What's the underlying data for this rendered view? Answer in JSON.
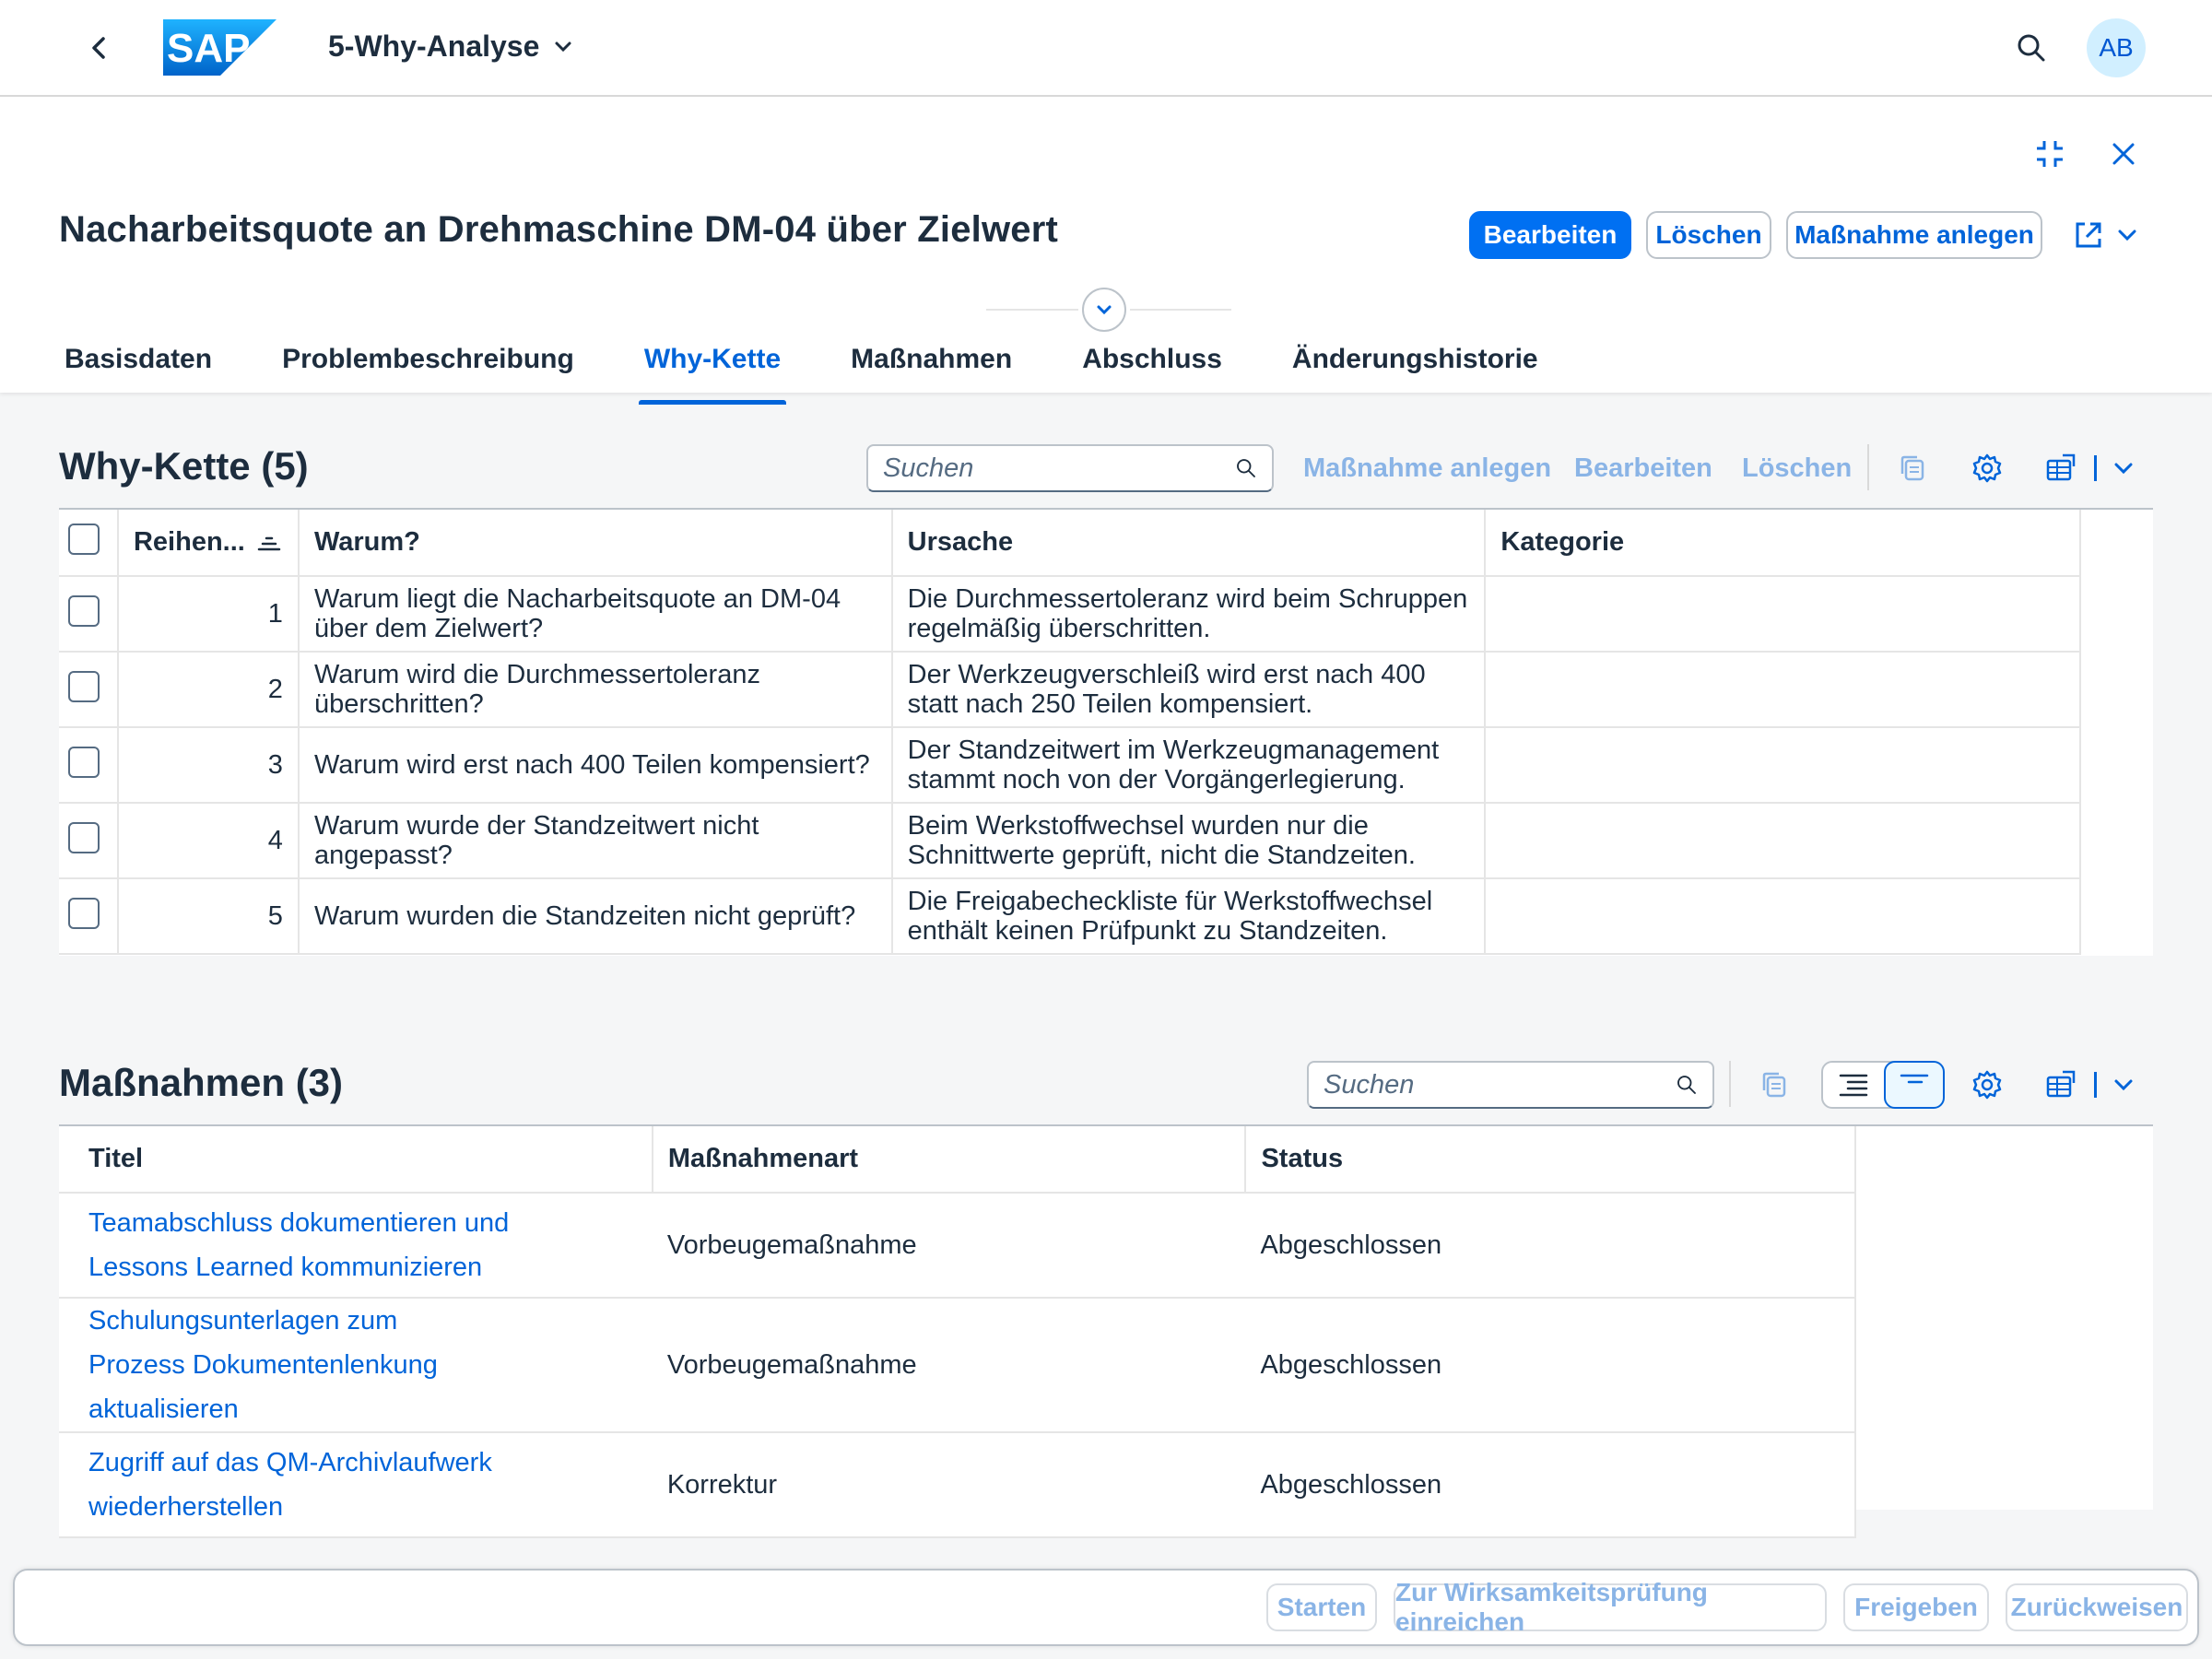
{
  "shell": {
    "app_title": "5-Why-Analyse",
    "logo_text": "SAP",
    "avatar_initials": "AB"
  },
  "header": {
    "title": "Nacharbeitsquote an Drehmaschine DM-04 über Zielwert",
    "buttons": {
      "edit": "Bearbeiten",
      "delete": "Löschen",
      "create_action": "Maßnahme anlegen"
    },
    "tabs": [
      "Basisdaten",
      "Problembeschreibung",
      "Why-Kette",
      "Maßnahmen",
      "Abschluss",
      "Änderungshistorie"
    ],
    "active_tab": "Why-Kette"
  },
  "why_chain": {
    "title": "Why-Kette (5)",
    "search_placeholder": "Suchen",
    "toolbar": {
      "create_action": "Maßnahme anlegen",
      "edit": "Bearbeiten",
      "delete": "Löschen"
    },
    "columns": [
      "Reihen...",
      "Warum?",
      "Ursache",
      "Kategorie"
    ],
    "rows": [
      {
        "order": "1",
        "why": "Warum liegt die Nacharbeitsquote an DM-04 über dem Zielwert?",
        "cause": "Die Durchmessertoleranz wird beim Schruppen regelmäßig überschritten.",
        "category": ""
      },
      {
        "order": "2",
        "why": "Warum wird die Durchmessertoleranz überschritten?",
        "cause": "Der Werkzeugverschleiß wird erst nach 400 statt nach 250 Teilen kompensiert.",
        "category": ""
      },
      {
        "order": "3",
        "why": "Warum wird erst nach 400 Teilen kompensiert?",
        "cause": "Der Standzeitwert im Werkzeugmanagement stammt noch von der Vorgängerlegierung.",
        "category": ""
      },
      {
        "order": "4",
        "why": "Warum wurde der Standzeitwert nicht angepasst?",
        "cause": "Beim Werkstoffwechsel wurden nur die Schnittwerte geprüft, nicht die Standzeiten.",
        "category": ""
      },
      {
        "order": "5",
        "why": "Warum wurden die Standzeiten nicht geprüft?",
        "cause": "Die Freigabecheckliste für Werkstoffwechsel enthält keinen Prüfpunkt zu Standzeiten.",
        "category": ""
      }
    ]
  },
  "measures": {
    "title": "Maßnahmen (3)",
    "search_placeholder": "Suchen",
    "columns": [
      "Titel",
      "Maßnahmenart",
      "Status"
    ],
    "rows": [
      {
        "title": "Teamabschluss dokumentieren und Lessons Learned kommunizieren",
        "type": "Vorbeugemaßnahme",
        "status": "Abgeschlossen"
      },
      {
        "title": "Schulungsunterlagen zum Prozess Dokumentenlenkung aktualisieren",
        "type": "Vorbeugemaßnahme",
        "status": "Abgeschlossen"
      },
      {
        "title": "Zugriff auf das QM-Archivlaufwerk wiederherstellen",
        "type": "Korrektur",
        "status": "Abgeschlossen"
      }
    ]
  },
  "footer": {
    "start": "Starten",
    "submit": "Zur Wirksamkeitsprüfung einreichen",
    "release": "Freigeben",
    "reject": "Zurückweisen"
  },
  "colors": {
    "accent": "#0070f2",
    "link": "#0064d9",
    "text": "#1d2d3e",
    "disabled": "#8ab4e6"
  }
}
